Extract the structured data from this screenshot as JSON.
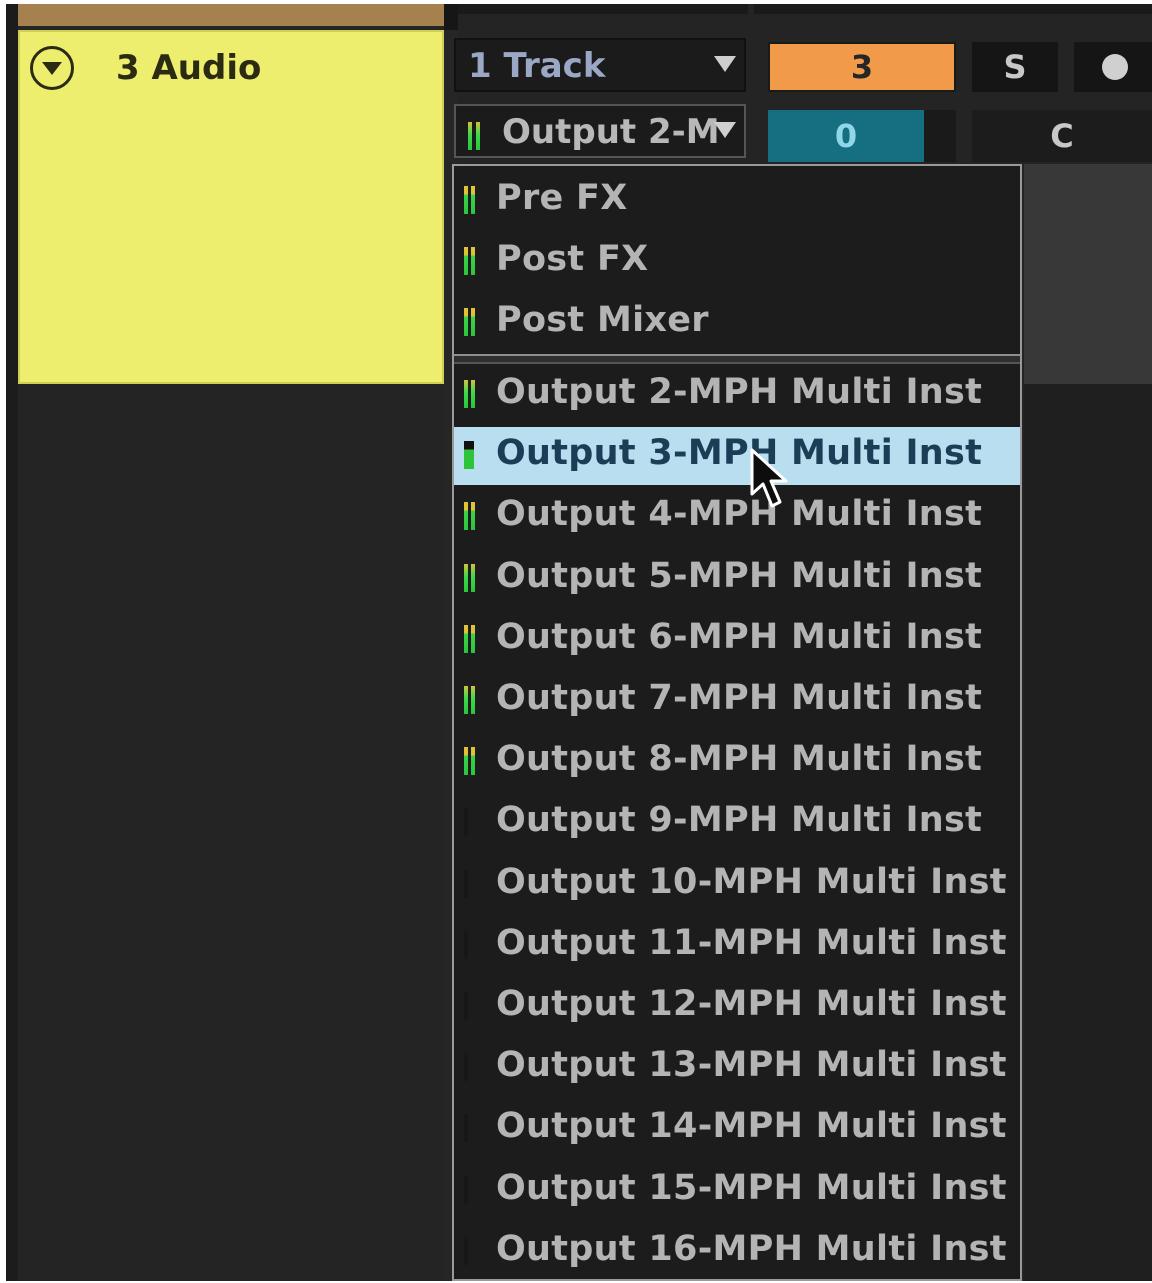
{
  "track": {
    "name": "3 Audio"
  },
  "io": {
    "input_label": "1 Track",
    "output_label": "Output 2-M"
  },
  "mixer": {
    "volume": "3",
    "solo_label": "S",
    "pan": "0",
    "center_label": "C"
  },
  "dropdown": {
    "tap_items": [
      {
        "label": "Pre FX",
        "meter": "full"
      },
      {
        "label": "Post FX",
        "meter": "full"
      },
      {
        "label": "Post Mixer",
        "meter": "full"
      }
    ],
    "output_items": [
      {
        "label": "Output 2-MPH Multi Inst",
        "meter": "low"
      },
      {
        "label": "Output 3-MPH Multi Inst",
        "meter": "selected"
      },
      {
        "label": "Output 4-MPH Multi Inst",
        "meter": "full"
      },
      {
        "label": "Output 5-MPH Multi Inst",
        "meter": "low"
      },
      {
        "label": "Output 6-MPH Multi Inst",
        "meter": "full"
      },
      {
        "label": "Output 7-MPH Multi Inst",
        "meter": "low"
      },
      {
        "label": "Output 8-MPH Multi Inst",
        "meter": "full"
      },
      {
        "label": "Output 9-MPH Multi Inst",
        "meter": "none"
      },
      {
        "label": "Output 10-MPH Multi Inst",
        "meter": "none"
      },
      {
        "label": "Output 11-MPH Multi Inst",
        "meter": "none"
      },
      {
        "label": "Output 12-MPH Multi Inst",
        "meter": "none"
      },
      {
        "label": "Output 13-MPH Multi Inst",
        "meter": "none"
      },
      {
        "label": "Output 14-MPH Multi Inst",
        "meter": "none"
      },
      {
        "label": "Output 15-MPH Multi Inst",
        "meter": "none"
      },
      {
        "label": "Output 16-MPH Multi Inst",
        "meter": "none"
      }
    ],
    "selected_index": 1
  },
  "colors": {
    "track_header": "#eeee6e",
    "volume_box": "#f19a4a",
    "pan_fill": "#166f80",
    "selected_item": "#b8def0"
  }
}
